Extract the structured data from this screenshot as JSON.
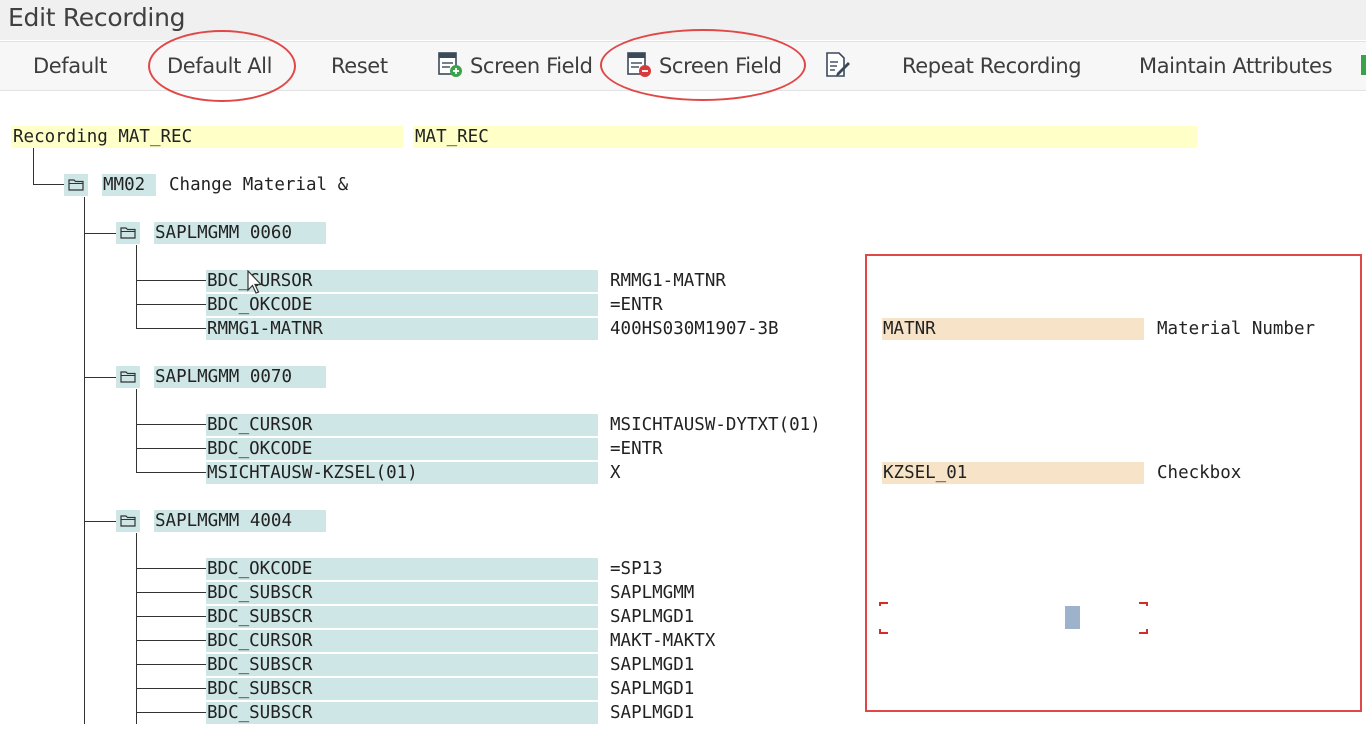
{
  "window": {
    "title": "Edit Recording"
  },
  "toolbar": {
    "default": "Default",
    "default_all": "Default All",
    "reset": "Reset",
    "screen_field_add": "Screen Field",
    "screen_field_remove": "Screen Field",
    "repeat_recording": "Repeat Recording",
    "maintain_attributes": "Maintain Attributes",
    "icons": [
      "screen-add-icon",
      "screen-remove-icon",
      "edit-document-icon",
      "execute-icon"
    ],
    "accent": "#e04848"
  },
  "tree": {
    "root": {
      "label": "Recording MAT_REC",
      "value": "MAT_REC"
    },
    "transaction": {
      "code": "MM02",
      "text": "Change Material &"
    },
    "screens": [
      {
        "program": "SAPLMGMM",
        "dynpro": "0060",
        "fields": [
          {
            "name": "BDC_CURSOR",
            "value": "RMMG1-MATNR"
          },
          {
            "name": "BDC_OKCODE",
            "value": "=ENTR"
          },
          {
            "name": "RMMG1-MATNR",
            "value": "400HS030M1907-3B",
            "attr": "MATNR",
            "desc": "Material Number"
          }
        ]
      },
      {
        "program": "SAPLMGMM",
        "dynpro": "0070",
        "fields": [
          {
            "name": "BDC_CURSOR",
            "value": "MSICHTAUSW-DYTXT(01)"
          },
          {
            "name": "BDC_OKCODE",
            "value": "=ENTR"
          },
          {
            "name": "MSICHTAUSW-KZSEL(01)",
            "value": "X",
            "attr": "KZSEL_01",
            "desc": "Checkbox"
          }
        ]
      },
      {
        "program": "SAPLMGMM",
        "dynpro": "4004",
        "fields": [
          {
            "name": "BDC_OKCODE",
            "value": "=SP13"
          },
          {
            "name": "BDC_SUBSCR",
            "value": "SAPLMGMM"
          },
          {
            "name": "BDC_SUBSCR",
            "value": "SAPLMGD1"
          },
          {
            "name": "BDC_CURSOR",
            "value": "MAKT-MAKTX"
          },
          {
            "name": "BDC_SUBSCR",
            "value": "SAPLMGD1"
          },
          {
            "name": "BDC_SUBSCR",
            "value": "SAPLMGD1"
          },
          {
            "name": "BDC_SUBSCR",
            "value": "SAPLMGD1"
          }
        ]
      }
    ]
  }
}
